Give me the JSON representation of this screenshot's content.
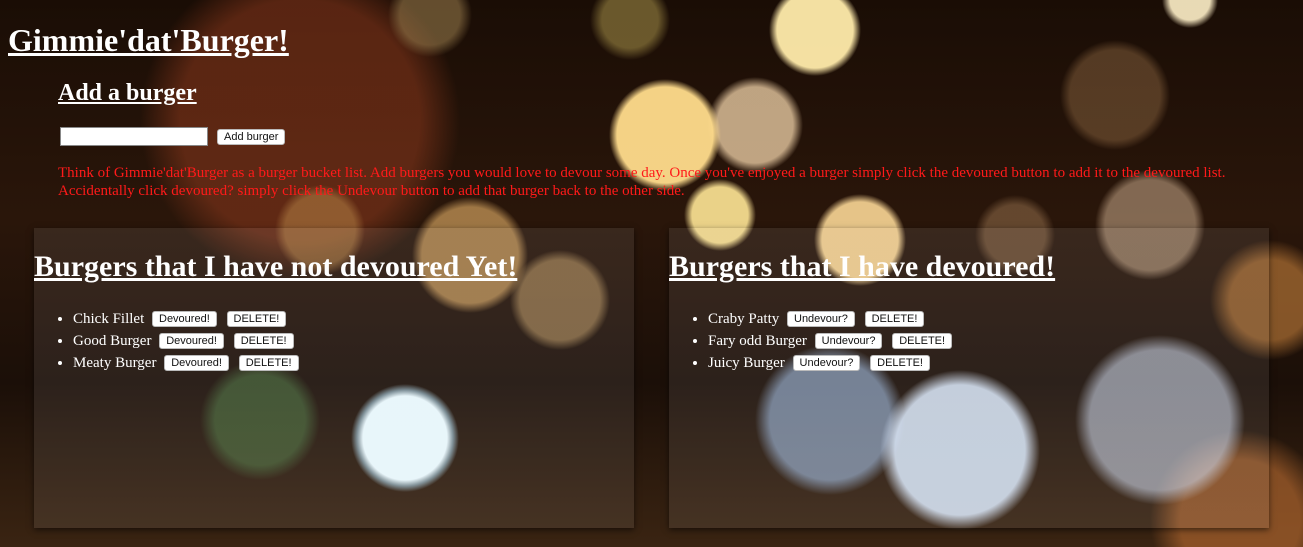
{
  "header": {
    "title": "Gimmie'dat'Burger!"
  },
  "add": {
    "heading": "Add a burger",
    "input_value": "",
    "input_placeholder": "",
    "button_label": "Add burger",
    "intro": "Think of Gimmie'dat'Burger as a burger bucket list. Add burgers you would love to devour some day. Once you've enjoyed a burger simply click the devoured button to add it to the devoured list. Accidentally click devoured? simply click the Undevour button to add that burger back to the other side."
  },
  "not_devoured": {
    "heading": "Burgers that I have not devoured Yet!",
    "items": [
      {
        "name": "Chick Fillet",
        "action_label": "Devoured!",
        "delete_label": "DELETE!"
      },
      {
        "name": "Good Burger",
        "action_label": "Devoured!",
        "delete_label": "DELETE!"
      },
      {
        "name": "Meaty Burger",
        "action_label": "Devoured!",
        "delete_label": "DELETE!"
      }
    ]
  },
  "devoured": {
    "heading": "Burgers that I have devoured!",
    "items": [
      {
        "name": "Craby Patty",
        "action_label": "Undevour?",
        "delete_label": "DELETE!"
      },
      {
        "name": "Fary odd Burger",
        "action_label": "Undevour?",
        "delete_label": "DELETE!"
      },
      {
        "name": "Juicy Burger",
        "action_label": "Undevour?",
        "delete_label": "DELETE!"
      }
    ]
  },
  "colors": {
    "intro_text": "#ff1a1a",
    "heading_text": "#ffffff"
  }
}
